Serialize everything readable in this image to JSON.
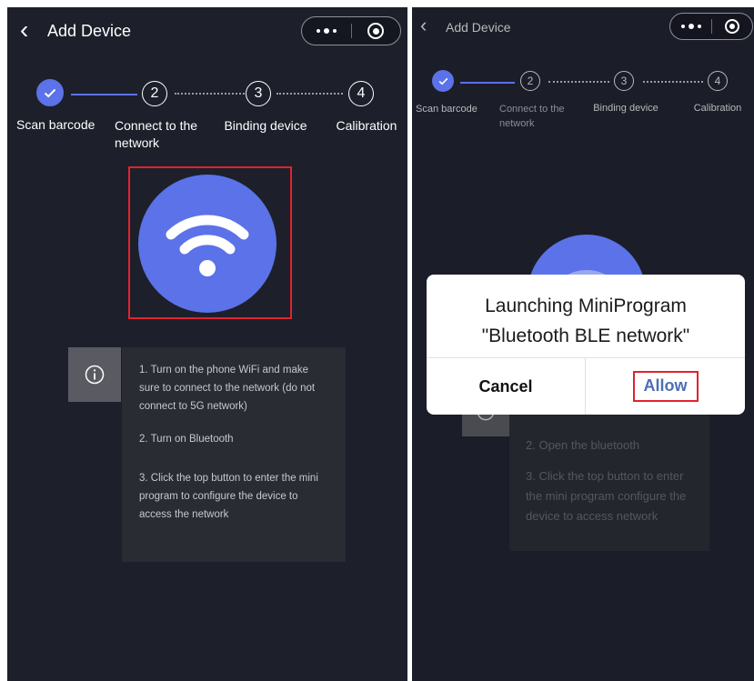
{
  "left": {
    "header": {
      "back_glyph": "‹",
      "title": "Add Device"
    },
    "steps": [
      {
        "number": "",
        "label": "Scan barcode",
        "state": "done"
      },
      {
        "number": "2",
        "label": "Connect to the network",
        "state": "pending"
      },
      {
        "number": "3",
        "label": "Binding device",
        "state": "pending"
      },
      {
        "number": "4",
        "label": "Calibration",
        "state": "pending"
      }
    ],
    "hero_icon": "wifi-icon",
    "instructions": [
      "1. Turn on the phone WiFi and make",
      "sure to connect to the network (do not",
      "connect to 5G network)",
      "2. Turn on Bluetooth",
      "3. Click the top button to enter the mini",
      "program to configure the device to",
      "access the network"
    ]
  },
  "right": {
    "header": {
      "back_glyph": "‹",
      "title": "Add Device"
    },
    "steps": [
      {
        "number": "",
        "label": "Scan barcode",
        "state": "done"
      },
      {
        "number": "2",
        "label_line1": "Connect to the",
        "label_line2": "network",
        "state": "pending"
      },
      {
        "number": "3",
        "label": "Binding device",
        "state": "pending"
      },
      {
        "number": "4",
        "label": "Calibration",
        "state": "pending"
      }
    ],
    "instructions": [
      "2. Open the bluetooth",
      "3. Click the top button to enter",
      "the mini program configure the",
      "device to access network"
    ],
    "dialog": {
      "line1": "Launching MiniProgram",
      "line2": "\"Bluetooth BLE network\"",
      "cancel_label": "Cancel",
      "allow_label": "Allow"
    }
  },
  "colors": {
    "background": "#1d1f2b",
    "accent": "#5b72e8",
    "highlight": "#e0232d",
    "allow_text": "#4d6fb3"
  }
}
